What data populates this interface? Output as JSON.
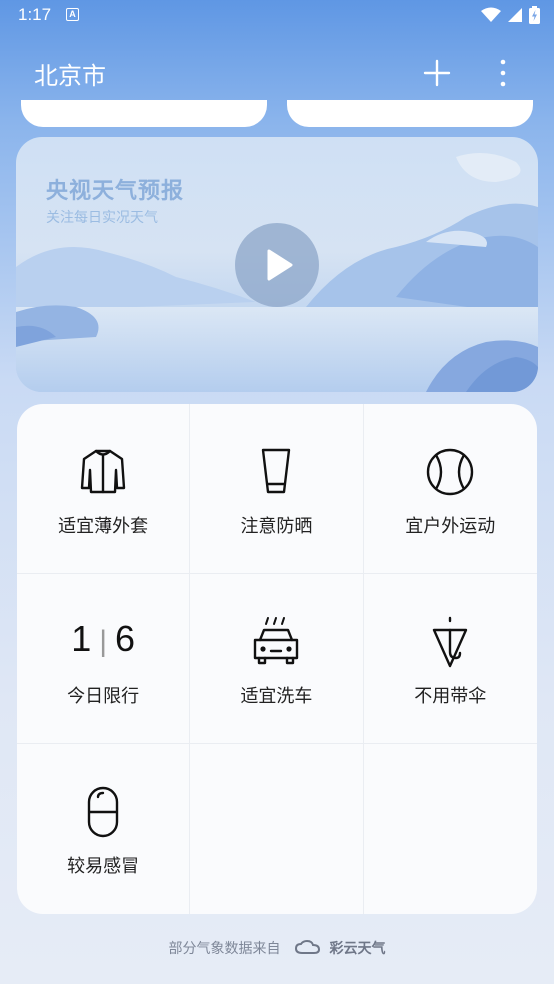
{
  "status_bar": {
    "time": "1:17",
    "notif": "A"
  },
  "header": {
    "city": "北京市"
  },
  "video": {
    "title": "央视天气预报",
    "subtitle": "关注每日实况天气"
  },
  "tips": [
    {
      "label": "适宜薄外套",
      "icon": "jacket-icon"
    },
    {
      "label": "注意防晒",
      "icon": "sunscreen-icon"
    },
    {
      "label": "宜户外运动",
      "icon": "baseball-icon"
    },
    {
      "label": "今日限行",
      "icon": "license-plate",
      "limit_a": "1",
      "limit_b": "6"
    },
    {
      "label": "适宜洗车",
      "icon": "car-wash-icon"
    },
    {
      "label": "不用带伞",
      "icon": "umbrella-icon"
    },
    {
      "label": "较易感冒",
      "icon": "capsule-icon"
    }
  ],
  "footer": {
    "source_text": "部分气象数据来自",
    "brand": "彩云天气"
  }
}
